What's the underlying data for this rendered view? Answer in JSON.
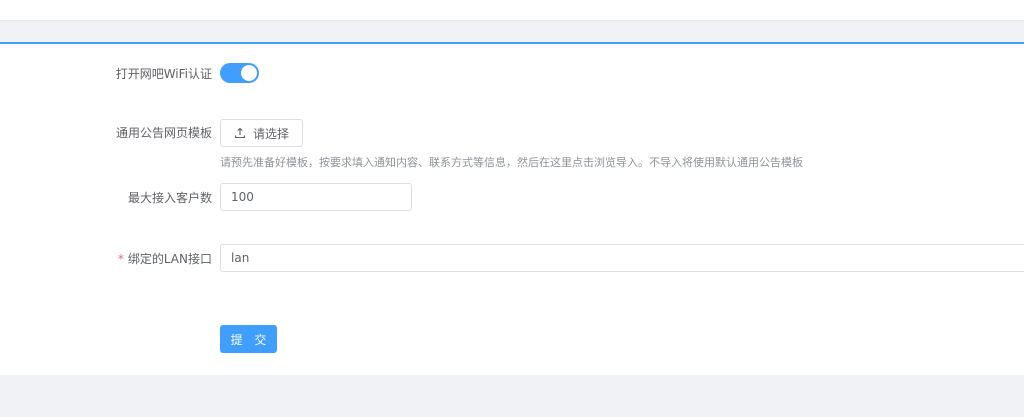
{
  "form": {
    "wifi_auth": {
      "label": "打开网吧WiFi认证",
      "enabled": true
    },
    "template": {
      "label": "通用公告网页模板",
      "button_label": "请选择",
      "button_icon": "upload-icon",
      "hint": "请预先准备好模板，按要求填入通知内容、联系方式等信息，然后在这里点击浏览导入。不导入将使用默认通用公告模板"
    },
    "max_clients": {
      "label": "最大接入客户数",
      "value": "100"
    },
    "lan_interface": {
      "required_mark": "*",
      "label": "绑定的LAN接口",
      "value": "lan"
    },
    "submit_label": "提 交"
  },
  "colors": {
    "primary": "#409eff",
    "required": "#f56c6c",
    "background": "#f0f2f5"
  }
}
